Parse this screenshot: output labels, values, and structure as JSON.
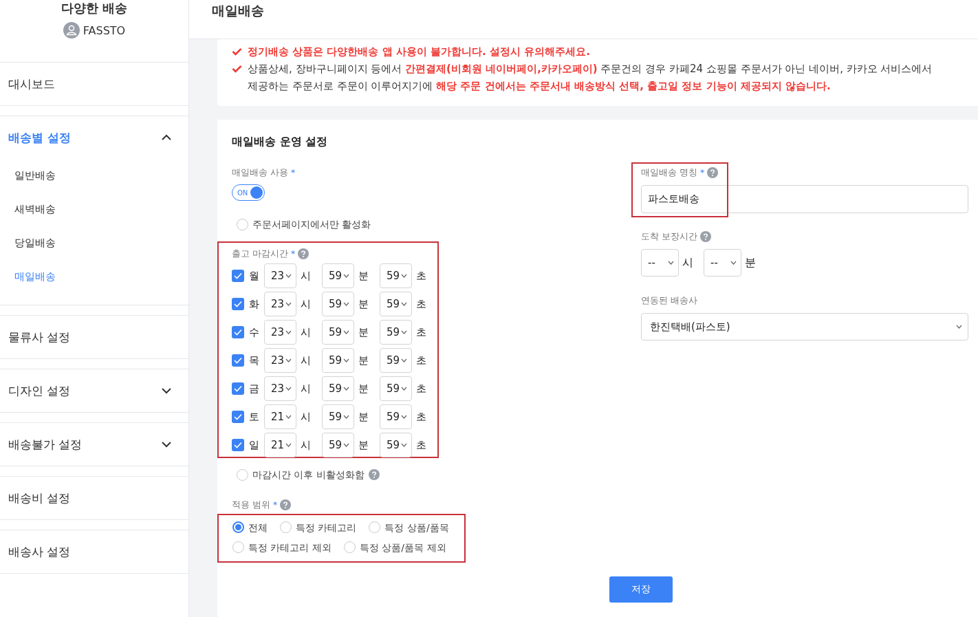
{
  "sidebar": {
    "title": "다양한 배송",
    "user": "FASSTO",
    "items": [
      {
        "kind": "link",
        "label": "대시보드",
        "selected": false
      },
      {
        "kind": "group",
        "label": "배송별 설정",
        "selected": true,
        "expanded": true,
        "children": [
          {
            "label": "일반배송",
            "selected": false
          },
          {
            "label": "새벽배송",
            "selected": false
          },
          {
            "label": "당일배송",
            "selected": false
          },
          {
            "label": "매일배송",
            "selected": true
          }
        ]
      },
      {
        "kind": "link",
        "label": "물류사 설정",
        "selected": false
      },
      {
        "kind": "group",
        "label": "디자인 설정",
        "selected": false,
        "expanded": false
      },
      {
        "kind": "group",
        "label": "배송불가 설정",
        "selected": false,
        "expanded": false
      },
      {
        "kind": "link",
        "label": "배송비 설정",
        "selected": false
      },
      {
        "kind": "link",
        "label": "배송사 설정",
        "selected": false
      }
    ]
  },
  "header": {
    "title": "매일배송"
  },
  "notices": [
    {
      "kind": "warning",
      "text": "정기배송 상품은 다양한배송 앱 사용이 불가합니다. 설정시 유의해주세요."
    },
    {
      "kind": "info",
      "text": "상품상세, 장바구니페이지 등에서 **간편결제(비회원 네이버페이,카카오페이)** 주문건의 경우 카페24 쇼핑몰 주문서가 아닌 네이버, 카카오 서비스에서 제공하는 주문서로 주문이 이루어지기에 **해당 주문 건에서는 주문서내 배송방식 선택, 출고일 정보 기능이 제공되지 않습니다.**"
    }
  ],
  "form": {
    "title": "매일배송 운영 설정",
    "enable": {
      "label": "매일배송 사용",
      "required_mark": "*",
      "toggle_label": "ON",
      "on": true
    },
    "order_page_only": {
      "label": "주문서페이지에서만 활성화",
      "selected": false
    },
    "cutoff": {
      "label": "출고 마감시간",
      "required_mark": "*",
      "days": [
        {
          "day": "월",
          "checked": true,
          "hour": "23",
          "hour_unit": "시",
          "minute": "59",
          "minute_unit": "분",
          "second": "59",
          "second_unit": "초"
        },
        {
          "day": "화",
          "checked": true,
          "hour": "23",
          "hour_unit": "시",
          "minute": "59",
          "minute_unit": "분",
          "second": "59",
          "second_unit": "초"
        },
        {
          "day": "수",
          "checked": true,
          "hour": "23",
          "hour_unit": "시",
          "minute": "59",
          "minute_unit": "분",
          "second": "59",
          "second_unit": "초"
        },
        {
          "day": "목",
          "checked": true,
          "hour": "23",
          "hour_unit": "시",
          "minute": "59",
          "minute_unit": "분",
          "second": "59",
          "second_unit": "초"
        },
        {
          "day": "금",
          "checked": true,
          "hour": "23",
          "hour_unit": "시",
          "minute": "59",
          "minute_unit": "분",
          "second": "59",
          "second_unit": "초"
        },
        {
          "day": "토",
          "checked": true,
          "hour": "21",
          "hour_unit": "시",
          "minute": "59",
          "minute_unit": "분",
          "second": "59",
          "second_unit": "초"
        },
        {
          "day": "일",
          "checked": true,
          "hour": "21",
          "hour_unit": "시",
          "minute": "59",
          "minute_unit": "분",
          "second": "59",
          "second_unit": "초"
        }
      ]
    },
    "disable_after_cutoff": {
      "label": "마감시간 이후 비활성화함",
      "selected": false
    },
    "scope": {
      "label": "적용 범위",
      "required_mark": "*",
      "options": [
        {
          "label": "전체",
          "selected": true
        },
        {
          "label": "특정 카테고리",
          "selected": false
        },
        {
          "label": "특정 상품/품목",
          "selected": false
        },
        {
          "label": "특정 카테고리 제외",
          "selected": false
        },
        {
          "label": "특정 상품/품목 제외",
          "selected": false
        }
      ]
    },
    "name": {
      "label": "매일배송 명칭",
      "required_mark": "*",
      "value": "파스토배송"
    },
    "arrival": {
      "label": "도착 보장시간",
      "hour": "--",
      "hour_unit": "시",
      "minute": "--",
      "minute_unit": "분"
    },
    "carrier": {
      "label": "연동된 배송사",
      "value": "한진택배(파스토)"
    },
    "save": "저장"
  }
}
